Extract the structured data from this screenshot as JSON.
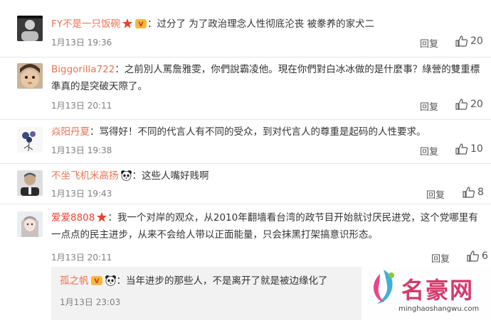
{
  "comments": [
    {
      "name": "FY不是一只饭碗",
      "text": "：过分了 为了政治理念人性彻底沦丧 被豢养的家犬二",
      "time": "1月13日 19:36",
      "reply": "回复",
      "likes": "20",
      "avatar_icon": "black-white-portrait-avatar",
      "badges": [
        "red-star-icon",
        "vip-crown-icon"
      ]
    },
    {
      "name": "Biggorilla722",
      "text": "：之前別人罵詹雅雯，你們說霸凌他。現在你們對白冰冰做的是什麼事？綠營的雙重標準真的是突破天際了。",
      "time": "1月13日 20:11",
      "reply": "回复",
      "likes": "20",
      "avatar_icon": "child-face-avatar",
      "badges": []
    },
    {
      "name": "焱阳丹夏",
      "text": "：骂得好！不同的代言人有不同的受众，到对代言人的尊重是起码的人性要求。",
      "time": "1月13日 19:38",
      "reply": "回复",
      "likes": "10",
      "avatar_icon": "flower-sketch-avatar",
      "badges": []
    },
    {
      "name": "不坐飞机米高扬",
      "text": "：这些人嘴好贱啊",
      "time": "1月13日 19:43",
      "reply": "回复",
      "likes": "8",
      "avatar_icon": "man-portrait-avatar",
      "badges": [
        "panda-icon"
      ]
    },
    {
      "name": "爱爱8808",
      "text": "：我一个对岸的观众，从2010年翻墙看台湾的政节目开始就讨厌民进党，这个党哪里有一点点的民主进步，从来不会给人带以正面能量，只会抹黑打架搞意识形态。",
      "time": "1月13日 20:11",
      "reply": "回复",
      "likes": "6",
      "avatar_icon": "anime-girl-avatar",
      "badges": [
        "red-star-icon"
      ]
    }
  ],
  "sub_comment": {
    "name": "孤之帆",
    "text": "：当年进步的那些人，不是离开了就是被边缘化了",
    "time": "1月13日 23:03",
    "badges": [
      "vip-crown-icon",
      "panda-icon"
    ]
  },
  "watermark": {
    "text": "名豪网",
    "url": "minghaoshangwu.com"
  },
  "colors": {
    "name": "#eb7350",
    "star": "#e8452e",
    "time": "#808080",
    "watermark": "#d43a6b"
  }
}
